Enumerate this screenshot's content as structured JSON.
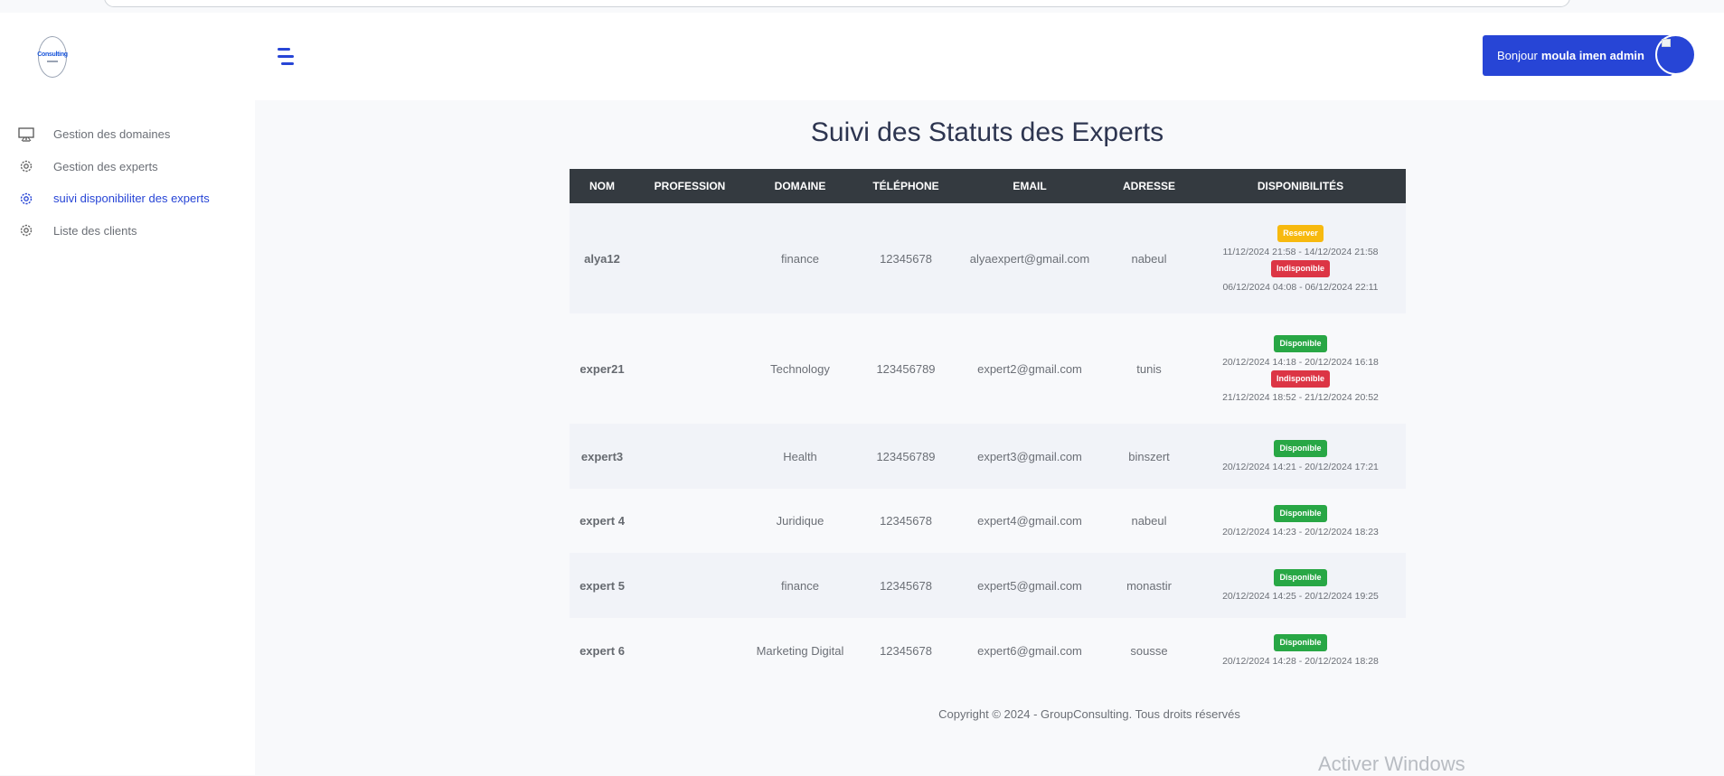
{
  "logo": {
    "text": "Consulting"
  },
  "sidebar": {
    "items": [
      {
        "label": "Gestion des domaines",
        "icon": "monitor-icon",
        "active": false
      },
      {
        "label": "Gestion des experts",
        "icon": "gear-icon",
        "active": false
      },
      {
        "label": "suivi disponibiliter des experts",
        "icon": "gear-icon",
        "active": true
      },
      {
        "label": "Liste des clients",
        "icon": "gear-icon",
        "active": false
      }
    ]
  },
  "header": {
    "greeting": "Bonjour",
    "user_name": "moula imen admin",
    "accent_color": "#2745d6"
  },
  "page_title": "Suivi des Statuts des Experts",
  "table": {
    "columns": [
      "NOM",
      "PROFESSION",
      "DOMAINE",
      "TÉLÉPHONE",
      "EMAIL",
      "ADRESSE",
      "DISPONIBILITÉS"
    ],
    "rows": [
      {
        "nom": "alya12",
        "profession": "",
        "domaine": "finance",
        "telephone": "12345678",
        "email": "alyaexpert@gmail.com",
        "adresse": "nabeul",
        "slots": [
          {
            "status": "Reserver",
            "type": "reserver",
            "range": "11/12/2024 21:58 - 14/12/2024 21:58"
          },
          {
            "status": "Indisponible",
            "type": "indispo",
            "range": "06/12/2024 04:08 - 06/12/2024 22:11"
          }
        ]
      },
      {
        "nom": "exper21",
        "profession": "",
        "domaine": "Technology",
        "telephone": "123456789",
        "email": "expert2@gmail.com",
        "adresse": "tunis",
        "slots": [
          {
            "status": "Disponible",
            "type": "dispo",
            "range": "20/12/2024 14:18 - 20/12/2024 16:18"
          },
          {
            "status": "Indisponible",
            "type": "indispo",
            "range": "21/12/2024 18:52 - 21/12/2024 20:52"
          }
        ]
      },
      {
        "nom": "expert3",
        "profession": "",
        "domaine": "Health",
        "telephone": "123456789",
        "email": "expert3@gmail.com",
        "adresse": "binszert",
        "slots": [
          {
            "status": "Disponible",
            "type": "dispo",
            "range": "20/12/2024 14:21 - 20/12/2024 17:21"
          }
        ]
      },
      {
        "nom": "expert 4",
        "profession": "",
        "domaine": "Juridique",
        "telephone": "12345678",
        "email": "expert4@gmail.com",
        "adresse": "nabeul",
        "slots": [
          {
            "status": "Disponible",
            "type": "dispo",
            "range": "20/12/2024 14:23 - 20/12/2024 18:23"
          }
        ]
      },
      {
        "nom": "expert 5",
        "profession": "",
        "domaine": "finance",
        "telephone": "12345678",
        "email": "expert5@gmail.com",
        "adresse": "monastir",
        "slots": [
          {
            "status": "Disponible",
            "type": "dispo",
            "range": "20/12/2024 14:25 - 20/12/2024 19:25"
          }
        ]
      },
      {
        "nom": "expert 6",
        "profession": "",
        "domaine": "Marketing Digital",
        "telephone": "12345678",
        "email": "expert6@gmail.com",
        "adresse": "sousse",
        "slots": [
          {
            "status": "Disponible",
            "type": "dispo",
            "range": "20/12/2024 14:28 - 20/12/2024 18:28"
          }
        ]
      }
    ]
  },
  "footer": "Copyright © 2024 - GroupConsulting. Tous droits réservés",
  "watermark": "Activer Windows"
}
